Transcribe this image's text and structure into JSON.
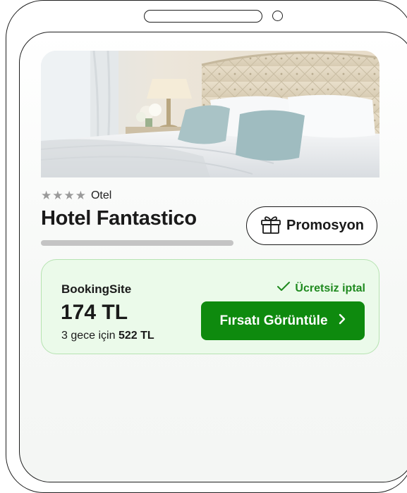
{
  "hotel": {
    "stars_display": "★★★★",
    "rating": 4,
    "type": "Otel",
    "name": "Hotel Fantastico",
    "promo_label": "Promosyon"
  },
  "deal": {
    "site": "BookingSite",
    "price": "174 TL",
    "total_prefix": "3 gece için",
    "total_amount": "522 TL",
    "free_cancel": "Ücretsiz iptal",
    "cta": "Fırsatı Görüntüle"
  },
  "colors": {
    "accent_green": "#0e8a0e",
    "card_background": "#ebfaea",
    "card_border": "#b6e3b1",
    "check_green": "#1f8a1f"
  },
  "icons": [
    "gift-icon",
    "check-icon",
    "chevron-right-icon"
  ]
}
